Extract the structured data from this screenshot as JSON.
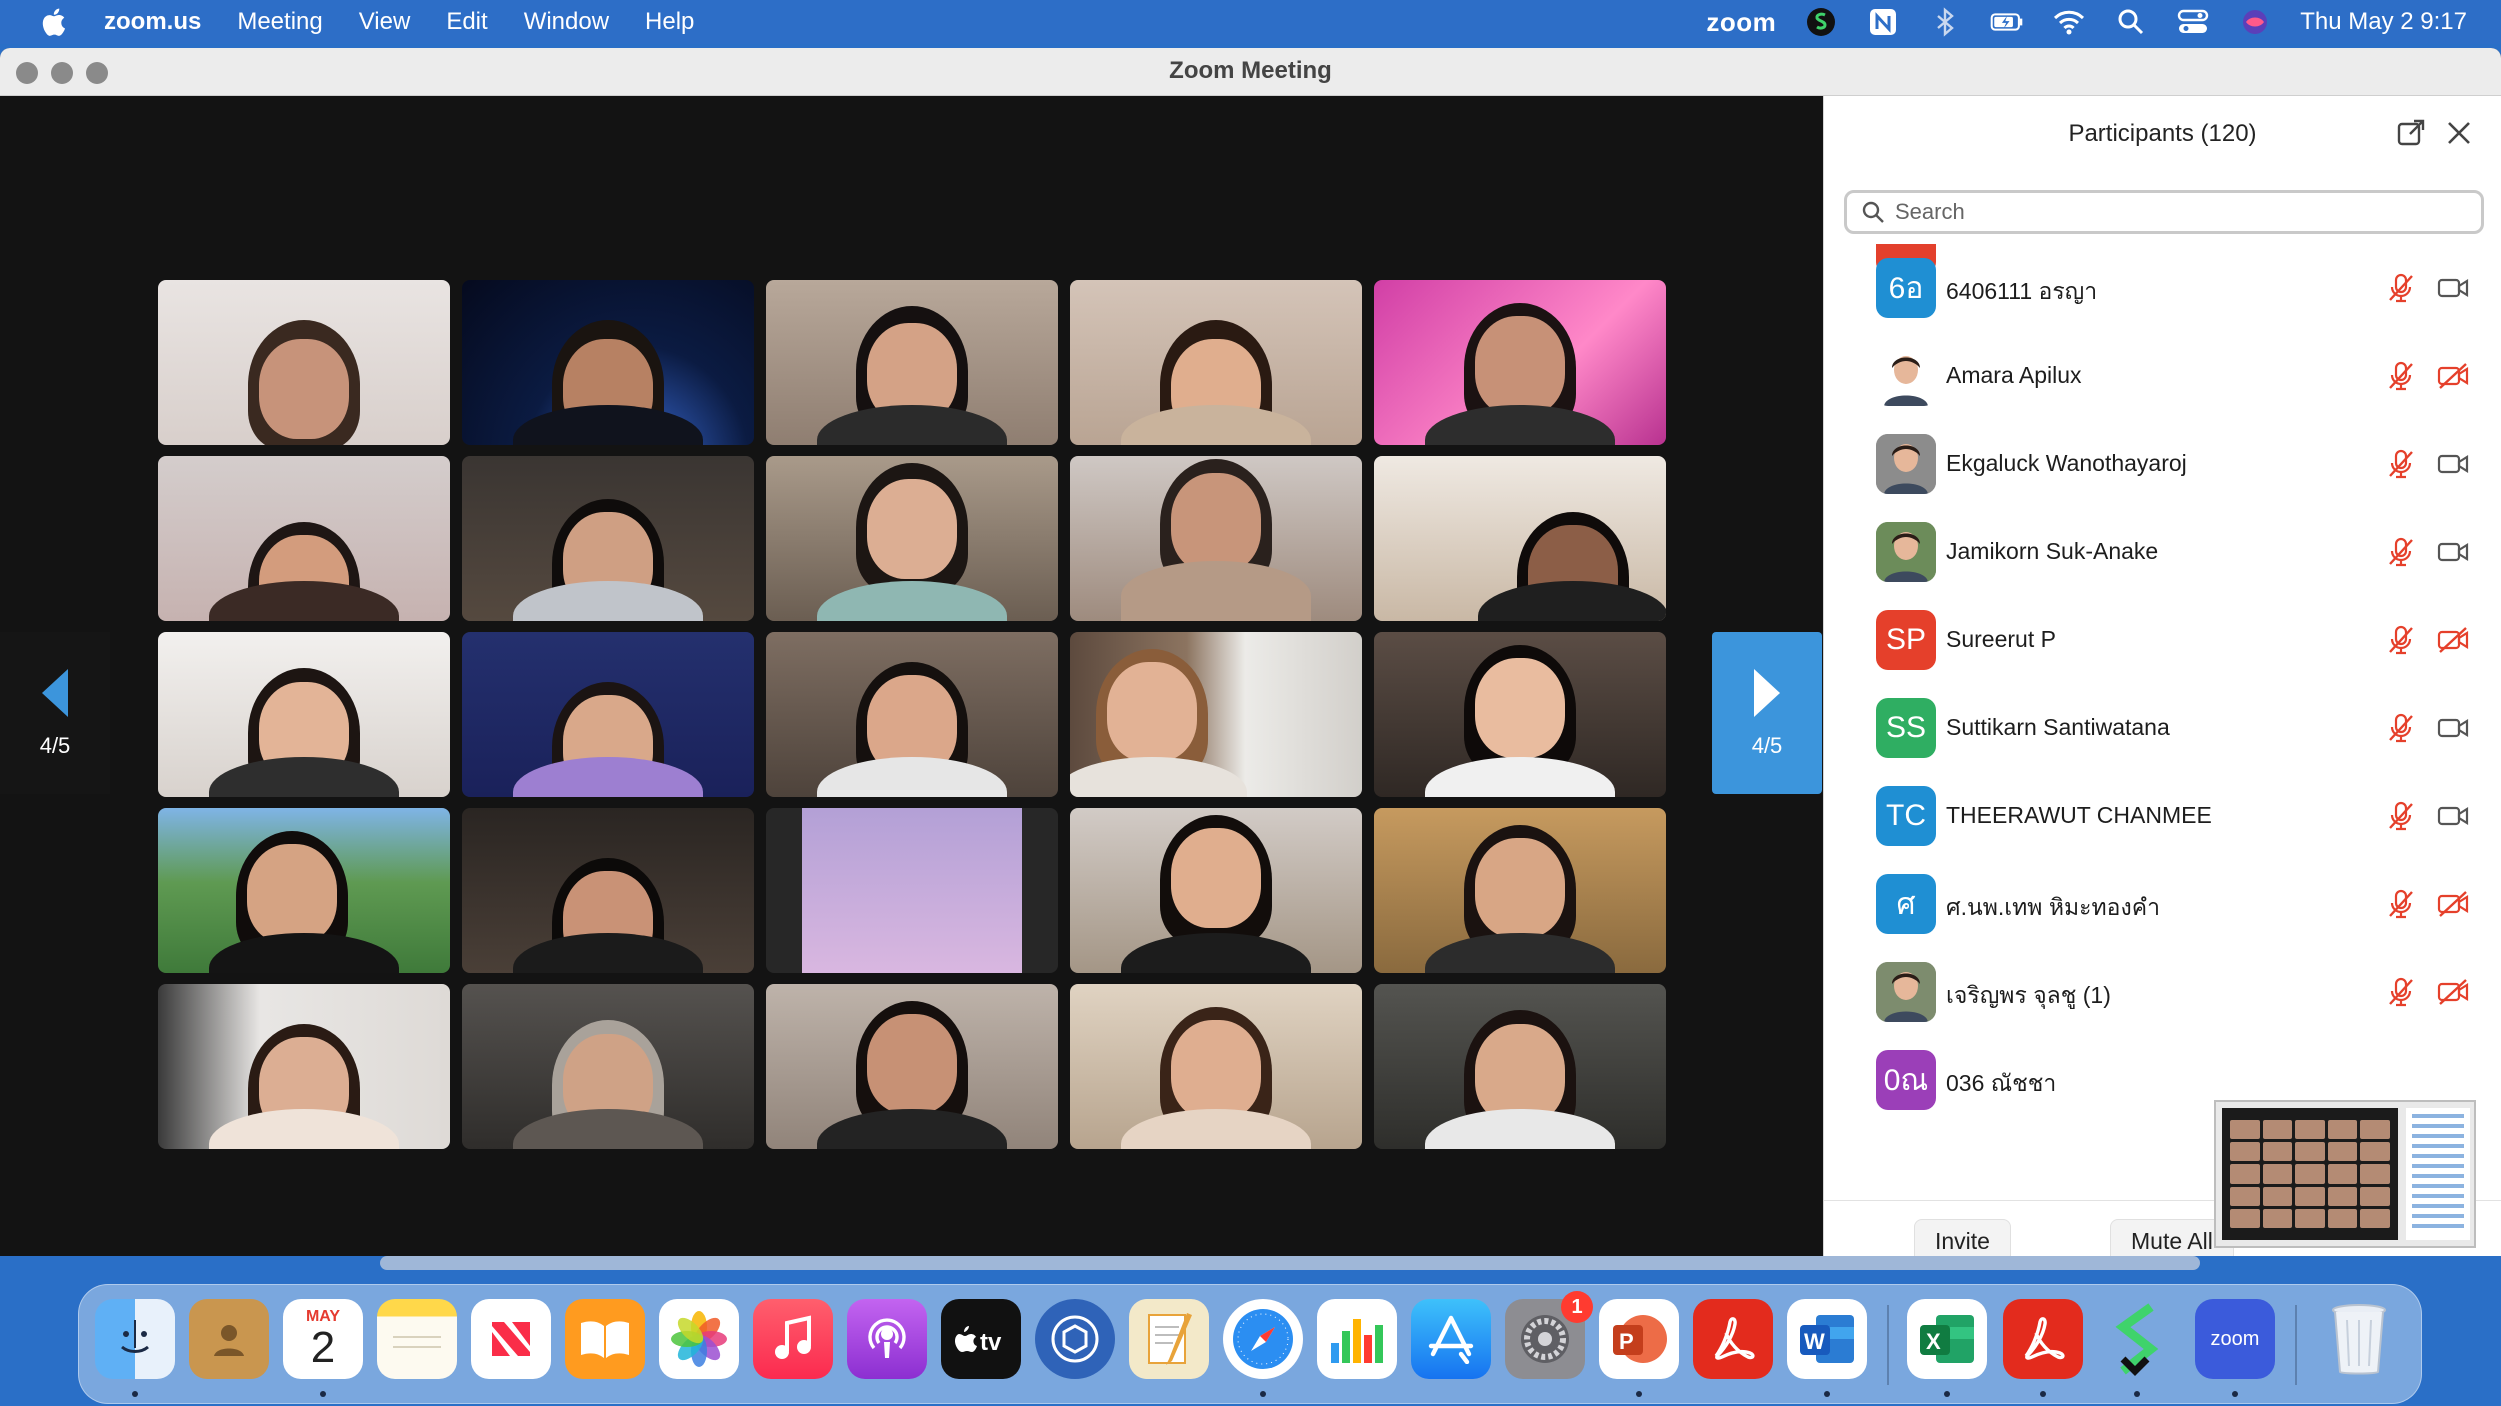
{
  "menubar": {
    "app_name": "zoom.us",
    "items": [
      "Meeting",
      "View",
      "Edit",
      "Window",
      "Help"
    ],
    "zoom_word": "zoom",
    "clock": "Thu May 2  9:17"
  },
  "window": {
    "title": "Zoom Meeting"
  },
  "gallery": {
    "page_indicator_left": "4/5",
    "page_indicator_right": "4/5",
    "tile_count": 25
  },
  "participants": {
    "title": "Participants (120)",
    "search_placeholder": "Search",
    "list": [
      {
        "initials": "6อ",
        "name": "6406111 อรญา",
        "color": "#1f8fd3",
        "photo": false,
        "mic_muted": true,
        "video_off": false
      },
      {
        "initials": "",
        "name": "Amara Apilux",
        "color": "#ffffff",
        "photo": true,
        "mic_muted": true,
        "video_off": true
      },
      {
        "initials": "",
        "name": "Ekgaluck Wanothayaroj",
        "color": "#8c8c8c",
        "photo": true,
        "mic_muted": true,
        "video_off": false
      },
      {
        "initials": "",
        "name": "Jamikorn Suk-Anake",
        "color": "#6c8c5a",
        "photo": true,
        "mic_muted": true,
        "video_off": false
      },
      {
        "initials": "SP",
        "name": "Sureerut P",
        "color": "#e5402b",
        "photo": false,
        "mic_muted": true,
        "video_off": true
      },
      {
        "initials": "SS",
        "name": "Suttikarn Santiwatana",
        "color": "#2fae62",
        "photo": false,
        "mic_muted": true,
        "video_off": false
      },
      {
        "initials": "TC",
        "name": "THEERAWUT CHANMEE",
        "color": "#1f8fd3",
        "photo": false,
        "mic_muted": true,
        "video_off": false
      },
      {
        "initials": "ศ",
        "name": "ศ.นพ.เทพ หิมะทองคำ",
        "color": "#1f8fd3",
        "photo": false,
        "mic_muted": true,
        "video_off": true
      },
      {
        "initials": "",
        "name": "เจริญพร จุลชู (1)",
        "color": "#7d8c6e",
        "photo": true,
        "mic_muted": true,
        "video_off": true
      },
      {
        "initials": "0ณ",
        "name": "036 ณัชชา",
        "color": "#9b3fb8",
        "photo": false,
        "mic_muted": false,
        "video_off": false
      }
    ],
    "invite_label": "Invite",
    "mute_all_label": "Mute All"
  },
  "dock": {
    "calendar_month": "MAY",
    "calendar_day": "2",
    "settings_badge": "1",
    "zoom_label": "zoom",
    "word_letter": "W",
    "excel_letter": "X",
    "powerpoint_letter": "P"
  },
  "colors": {
    "menubar": "#2d6ec7",
    "accent_blue": "#3c95dc",
    "muted_red": "#e5402b"
  }
}
